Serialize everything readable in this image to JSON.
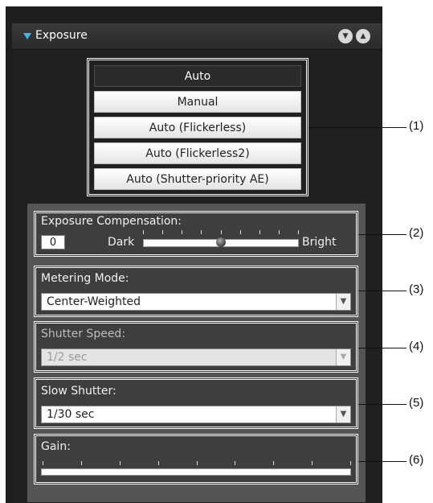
{
  "header": {
    "title": "Exposure",
    "collapse_icon": "chevron-down-icon",
    "expand_icon": "chevron-up-icon"
  },
  "mode_list": {
    "items": [
      "Auto",
      "Manual",
      "Auto (Flickerless)",
      "Auto (Flickerless2)",
      "Auto (Shutter-priority AE)"
    ],
    "selected_index": 0
  },
  "exposure_compensation": {
    "label": "Exposure Compensation:",
    "value": "0",
    "min_label": "Dark",
    "max_label": "Bright",
    "slider_position": 0.5,
    "tick_count": 9
  },
  "metering_mode": {
    "label": "Metering Mode:",
    "value": "Center-Weighted"
  },
  "shutter_speed": {
    "label": "Shutter Speed:",
    "value": "1/2 sec",
    "disabled": true
  },
  "slow_shutter": {
    "label": "Slow Shutter:",
    "value": "1/30 sec"
  },
  "gain": {
    "label": "Gain:",
    "tick_count": 9
  },
  "callouts": [
    "(1)",
    "(2)",
    "(3)",
    "(4)",
    "(5)",
    "(6)"
  ],
  "colors": {
    "accent": "#3fb6ee",
    "panel": "#1e1e1e",
    "selected_item": "#2b2b2b"
  }
}
